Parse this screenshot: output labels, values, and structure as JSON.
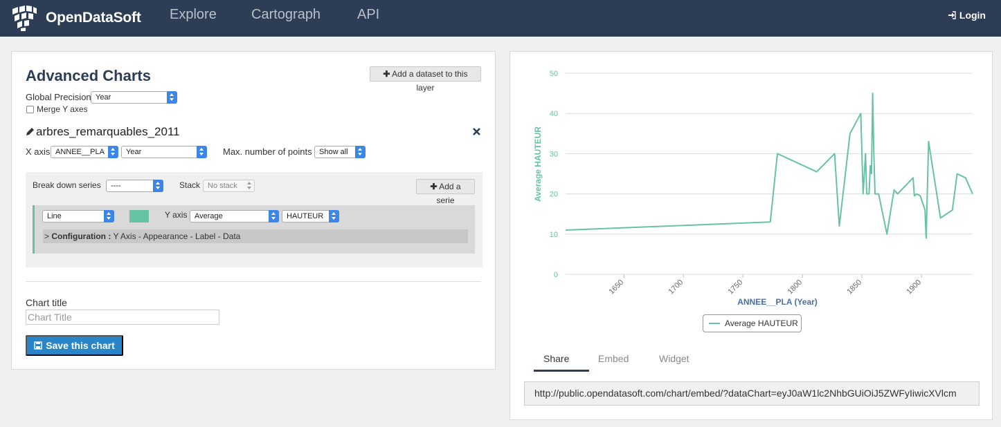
{
  "nav": {
    "brand": "OpenDataSoft",
    "items": [
      "Explore",
      "Cartograph",
      "API"
    ],
    "login": "Login"
  },
  "left": {
    "title": "Advanced Charts",
    "add_dataset": "Add a dataset to this layer",
    "global_precision_label": "Global Precision",
    "global_precision_value": "Year",
    "merge_y_label": "Merge Y axes",
    "dataset_name": "arbres_remarquables_2011",
    "x_axis_label": "X axis",
    "x_axis_field": "ANNEE__PLA",
    "x_axis_precision": "Year",
    "max_points_label": "Max. number of points",
    "max_points_value": "Show all",
    "breakdown_label": "Break down series",
    "breakdown_value": "----",
    "stack_label": "Stack",
    "stack_value": "No stack",
    "add_serie": "Add a serie",
    "serie_type": "Line",
    "serie_color": "#66c2a5",
    "y_axis_label": "Y axis",
    "y_func": "Average",
    "y_field": "HAUTEUR",
    "config_prefix": "> ",
    "config_label": "Configuration :",
    "config_links": " Y Axis - Appearance - Label - Data",
    "chart_title_label": "Chart title",
    "chart_title_placeholder": "Chart Title",
    "save_button": "Save this chart"
  },
  "right": {
    "tabs": [
      "Share",
      "Embed",
      "Widget"
    ],
    "active_tab": "Share",
    "share_url": "http://public.opendatasoft.com/chart/embed/?dataChart=eyJ0aW1lc2NhbGUiOiJ5ZWFyIiwicXVlcm"
  },
  "chart_data": {
    "type": "line",
    "xlabel": "ANNEE__PLA (Year)",
    "ylabel": "Average HAUTEUR",
    "ylim": [
      0,
      50
    ],
    "xlim": [
      1601,
      1943
    ],
    "xticks": [
      1650,
      1700,
      1750,
      1800,
      1850,
      1900
    ],
    "yticks": [
      0,
      10,
      20,
      30,
      40,
      50
    ],
    "grid": true,
    "legend": "bottom-center",
    "series": [
      {
        "name": "Average HAUTEUR",
        "color": "#66c2a5",
        "x": [
          1601,
          1773,
          1779,
          1812,
          1827,
          1831,
          1840,
          1849,
          1851,
          1853,
          1854,
          1856,
          1857,
          1858,
          1859,
          1860,
          1861,
          1864,
          1871,
          1877,
          1880,
          1893,
          1894,
          1896,
          1899,
          1903,
          1904,
          1906,
          1916,
          1926,
          1930,
          1937,
          1943
        ],
        "y": [
          11,
          13,
          30,
          25.5,
          30,
          12,
          35,
          40,
          20,
          30,
          20,
          20,
          27,
          25,
          45,
          30,
          20,
          20,
          10,
          21,
          20,
          24,
          19.5,
          20,
          19.5,
          16,
          9,
          33,
          14,
          16,
          25,
          24,
          20
        ]
      }
    ]
  }
}
